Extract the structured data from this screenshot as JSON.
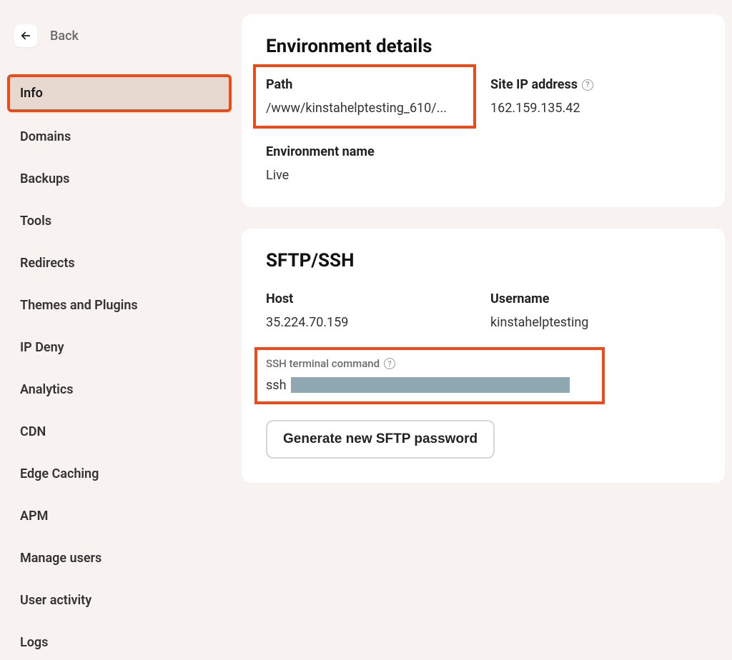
{
  "back_label": "Back",
  "sidebar": {
    "items": [
      {
        "label": "Info",
        "active": true
      },
      {
        "label": "Domains",
        "active": false
      },
      {
        "label": "Backups",
        "active": false
      },
      {
        "label": "Tools",
        "active": false
      },
      {
        "label": "Redirects",
        "active": false
      },
      {
        "label": "Themes and Plugins",
        "active": false
      },
      {
        "label": "IP Deny",
        "active": false
      },
      {
        "label": "Analytics",
        "active": false
      },
      {
        "label": "CDN",
        "active": false
      },
      {
        "label": "Edge Caching",
        "active": false
      },
      {
        "label": "APM",
        "active": false
      },
      {
        "label": "Manage users",
        "active": false
      },
      {
        "label": "User activity",
        "active": false
      },
      {
        "label": "Logs",
        "active": false
      }
    ]
  },
  "env_details": {
    "title": "Environment details",
    "path_label": "Path",
    "path_value": "/www/kinstahelptesting_610/...",
    "ip_label": "Site IP address",
    "ip_value": "162.159.135.42",
    "env_name_label": "Environment name",
    "env_name_value": "Live"
  },
  "sftp": {
    "title": "SFTP/SSH",
    "host_label": "Host",
    "host_value": "35.224.70.159",
    "username_label": "Username",
    "username_value": "kinstahelptesting",
    "ssh_label": "SSH terminal command",
    "ssh_prefix": "ssh",
    "generate_button": "Generate new SFTP password"
  },
  "help_char": "?"
}
